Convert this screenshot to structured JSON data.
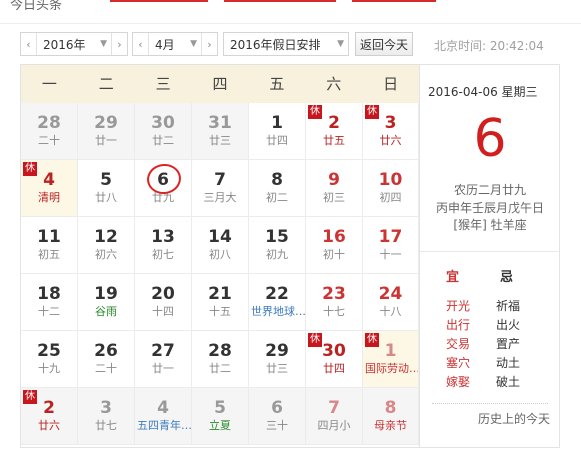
{
  "top": {
    "partial_text": "今日头条"
  },
  "toolbar": {
    "year": "2016年",
    "month": "4月",
    "holiday": "2016年假日安排",
    "today_button": "返回今天",
    "beijing_time": "北京时间: 20:42:04"
  },
  "weekdays": [
    "一",
    "二",
    "三",
    "四",
    "五",
    "六",
    "日"
  ],
  "rest_badge": "休",
  "days": [
    {
      "d": "28",
      "l": "二十",
      "other": true
    },
    {
      "d": "29",
      "l": "廿一",
      "other": true
    },
    {
      "d": "30",
      "l": "廿二",
      "other": true
    },
    {
      "d": "31",
      "l": "廿三",
      "other": true
    },
    {
      "d": "1",
      "l": "廿四"
    },
    {
      "d": "2",
      "l": "廿五",
      "weekend": true,
      "rest": true,
      "holiday": true
    },
    {
      "d": "3",
      "l": "廿六",
      "weekend": true,
      "rest": true,
      "holiday": true
    },
    {
      "d": "4",
      "l": "清明",
      "rest": true,
      "holiday": true,
      "restbg": true
    },
    {
      "d": "5",
      "l": "廿八"
    },
    {
      "d": "6",
      "l": "廿九",
      "today": true
    },
    {
      "d": "7",
      "l": "三月大"
    },
    {
      "d": "8",
      "l": "初二"
    },
    {
      "d": "9",
      "l": "初三",
      "weekend": true
    },
    {
      "d": "10",
      "l": "初四",
      "weekend": true
    },
    {
      "d": "11",
      "l": "初五"
    },
    {
      "d": "12",
      "l": "初六"
    },
    {
      "d": "13",
      "l": "初七"
    },
    {
      "d": "14",
      "l": "初八"
    },
    {
      "d": "15",
      "l": "初九"
    },
    {
      "d": "16",
      "l": "初十",
      "weekend": true
    },
    {
      "d": "17",
      "l": "十一",
      "weekend": true
    },
    {
      "d": "18",
      "l": "十二"
    },
    {
      "d": "19",
      "l": "谷雨",
      "term": true
    },
    {
      "d": "20",
      "l": "十四"
    },
    {
      "d": "21",
      "l": "十五"
    },
    {
      "d": "22",
      "l": "世界地球…",
      "intl": true
    },
    {
      "d": "23",
      "l": "十七",
      "weekend": true
    },
    {
      "d": "24",
      "l": "十八",
      "weekend": true
    },
    {
      "d": "25",
      "l": "十九"
    },
    {
      "d": "26",
      "l": "二十"
    },
    {
      "d": "27",
      "l": "廿一"
    },
    {
      "d": "28",
      "l": "廿二"
    },
    {
      "d": "29",
      "l": "廿三"
    },
    {
      "d": "30",
      "l": "廿四",
      "weekend": true,
      "rest": true,
      "holiday": true
    },
    {
      "d": "1",
      "l": "国际劳动…",
      "other": true,
      "weekend": true,
      "rest": true,
      "festival": true,
      "restbg": true
    },
    {
      "d": "2",
      "l": "廿六",
      "other": true,
      "rest": true,
      "holiday": true
    },
    {
      "d": "3",
      "l": "廿七",
      "other": true
    },
    {
      "d": "4",
      "l": "五四青年…",
      "other": true,
      "intl": true
    },
    {
      "d": "5",
      "l": "立夏",
      "other": true,
      "term": true
    },
    {
      "d": "6",
      "l": "三十",
      "other": true
    },
    {
      "d": "7",
      "l": "四月小",
      "other": true,
      "weekend": true
    },
    {
      "d": "8",
      "l": "母亲节",
      "other": true,
      "weekend": true,
      "festival": true
    }
  ],
  "side": {
    "date_line": "2016-04-06  星期三",
    "big_day": "6",
    "lunar": "农历二月廿九",
    "ganzhi": "丙申年壬辰月戊午日",
    "zodiac": "[猴年] 牡羊座",
    "yi_label": "宜",
    "ji_label": "忌",
    "yi": [
      "开光",
      "出行",
      "交易",
      "塞穴",
      "嫁娶"
    ],
    "ji": [
      "祈福",
      "出火",
      "置产",
      "动土",
      "破土"
    ],
    "history": "历史上的今天"
  },
  "colors": {
    "accent": "#d01f1f",
    "header_bg": "#f7f1dd",
    "rest_badge": "#c7161e"
  }
}
